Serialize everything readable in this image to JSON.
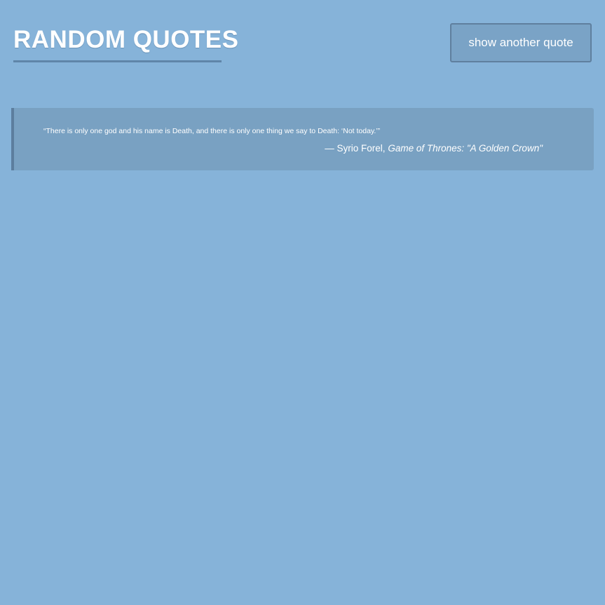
{
  "header": {
    "title": "RANDOM QUOTES"
  },
  "controls": {
    "another_label": "show another quote"
  },
  "quote": {
    "text": "“There is only one god and his name is Death, and there is only one thing we say to Death: ‘Not today.’”",
    "author": "— Syrio Forel,",
    "source": "Game of Thrones: \"A Golden Crown\""
  },
  "colors": {
    "background": "#86b3d9",
    "card": "#79a1c2",
    "accent": "#5f85a8",
    "text": "#ffffff"
  }
}
